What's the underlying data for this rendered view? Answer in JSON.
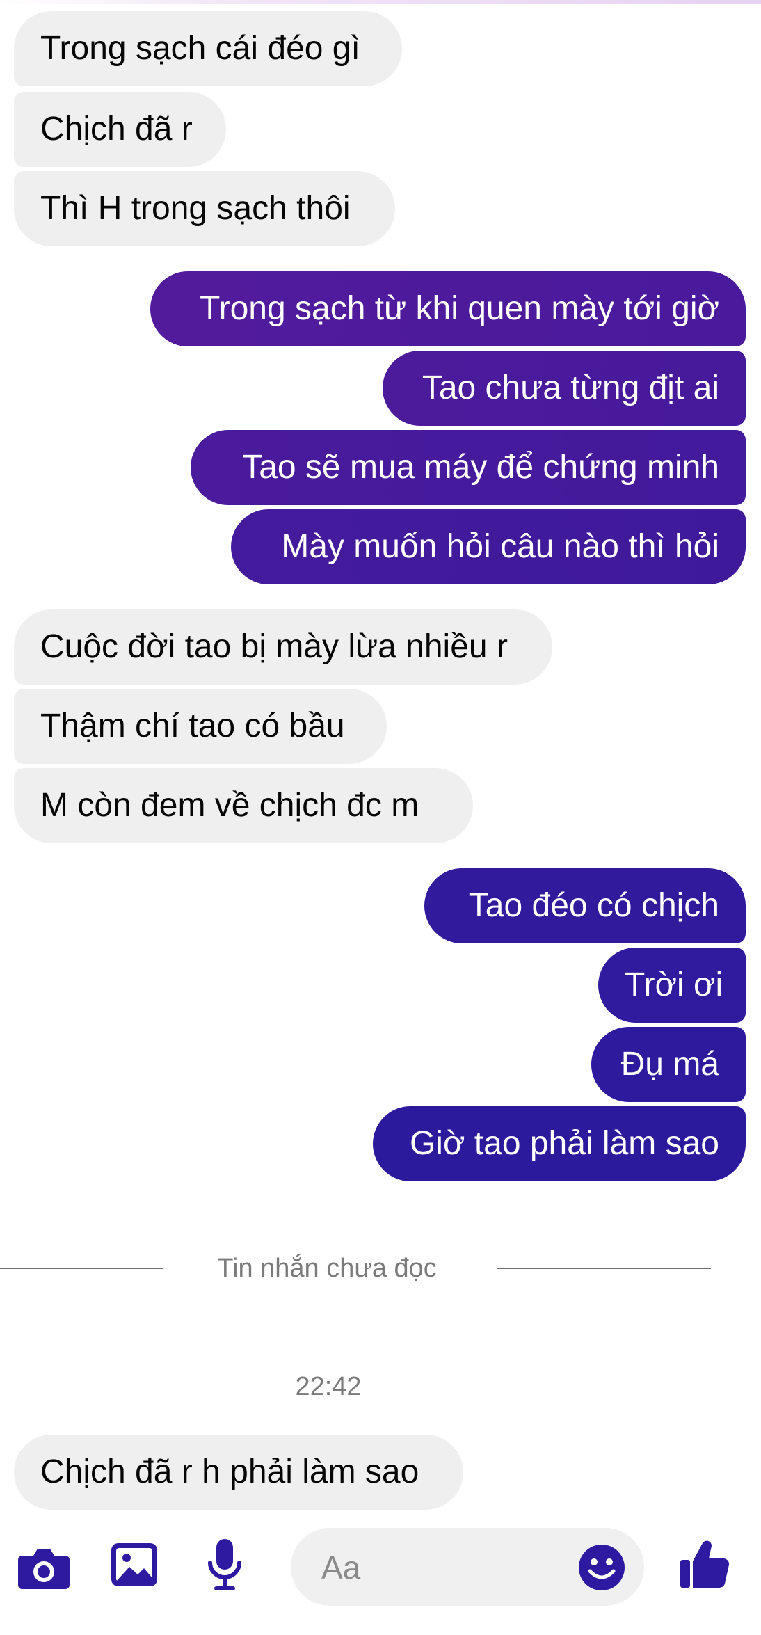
{
  "colors": {
    "accent": "#2e1aa0",
    "incoming_bubble": "#efefef",
    "outgoing_gradient_start": "#521b9c",
    "outgoing_gradient_end": "#2a1b9a"
  },
  "messages": [
    {
      "dir": "in",
      "text": "Trong sạch cái đéo gì"
    },
    {
      "dir": "in",
      "text": "Chịch đã r"
    },
    {
      "dir": "in",
      "text": "Thì H trong sạch thôi"
    },
    {
      "dir": "out",
      "text": "Trong sạch từ khi quen mày tới giờ"
    },
    {
      "dir": "out",
      "text": "Tao chưa từng địt ai"
    },
    {
      "dir": "out",
      "text": "Tao sẽ mua máy để chứng minh"
    },
    {
      "dir": "out",
      "text": "Mày muốn hỏi câu nào thì hỏi"
    },
    {
      "dir": "in",
      "text": "Cuộc đời tao bị mày lừa nhiều r"
    },
    {
      "dir": "in",
      "text": "Thậm chí tao có bầu"
    },
    {
      "dir": "in",
      "text": "M còn đem về chịch đc m"
    },
    {
      "dir": "out",
      "text": "Tao đéo có chịch"
    },
    {
      "dir": "out",
      "text": "Trời ơi"
    },
    {
      "dir": "out",
      "text": "Đụ má"
    },
    {
      "dir": "out",
      "text": "Giờ tao phải làm sao"
    },
    {
      "dir": "in",
      "text": "Chịch đã r h phải làm sao"
    }
  ],
  "unread_divider": "Tin nhắn chưa đọc",
  "timestamp": "22:42",
  "composer": {
    "placeholder": "Aa",
    "icons": [
      "camera-icon",
      "gallery-icon",
      "microphone-icon",
      "emoji-icon",
      "thumbs-up-icon"
    ]
  }
}
